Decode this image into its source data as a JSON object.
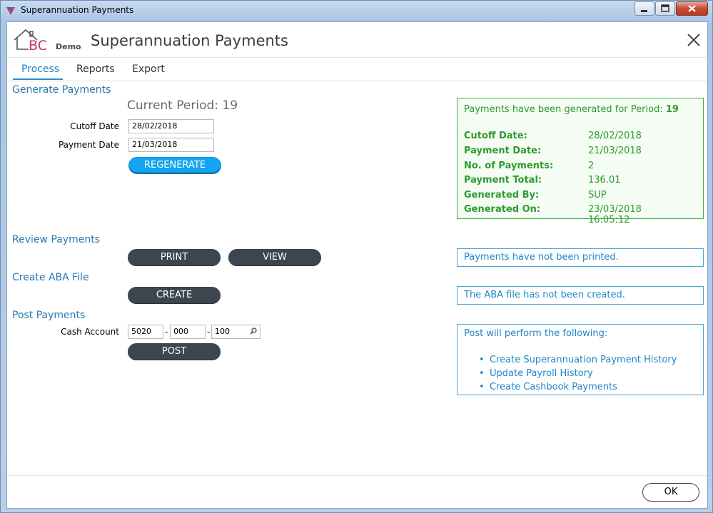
{
  "window": {
    "title": "Superannuation Payments"
  },
  "header": {
    "logo_text": "BC",
    "logo_sub": "Demo",
    "title": "Superannuation Payments"
  },
  "tabs": [
    {
      "label": "Process"
    },
    {
      "label": "Reports"
    },
    {
      "label": "Export"
    }
  ],
  "generate": {
    "section_title": "Generate Payments",
    "current_period": "Current Period: 19",
    "cutoff_label": "Cutoff Date",
    "cutoff_value": "28/02/2018",
    "payment_label": "Payment Date",
    "payment_value": "21/03/2018",
    "regenerate_label": "REGENERATE"
  },
  "summary": {
    "header_text": "Payments have been generated for Period: ",
    "header_period": "19",
    "rows": [
      {
        "label": "Cutoff Date:",
        "value": "28/02/2018"
      },
      {
        "label": "Payment Date:",
        "value": "21/03/2018"
      },
      {
        "label": "No. of Payments:",
        "value": "2"
      },
      {
        "label": "Payment Total:",
        "value": "136.01"
      },
      {
        "label": "Generated By:",
        "value": "SUP"
      },
      {
        "label": "Generated On:",
        "value": "23/03/2018 16:05:12"
      }
    ]
  },
  "review": {
    "section_title": "Review Payments",
    "print_label": "PRINT",
    "view_label": "VIEW",
    "status": "Payments have not been printed."
  },
  "aba": {
    "section_title": "Create ABA File",
    "create_label": "CREATE",
    "status": "The ABA file has not been created."
  },
  "post": {
    "section_title": "Post Payments",
    "cash_account_label": "Cash Account",
    "account_part1": "5020",
    "account_part2": "000",
    "account_part3": "100",
    "separator": "-",
    "post_label": "POST",
    "info_header": "Post will perform the following:",
    "info_items": [
      "Create Superannuation Payment History",
      "Update Payroll History",
      "Create Cashbook Payments"
    ]
  },
  "footer": {
    "ok_label": "OK"
  },
  "colors": {
    "accent": "#1e84c6",
    "success": "#2f9a2f",
    "button_dark": "#3d454f",
    "button_blue": "#13a5f0"
  }
}
